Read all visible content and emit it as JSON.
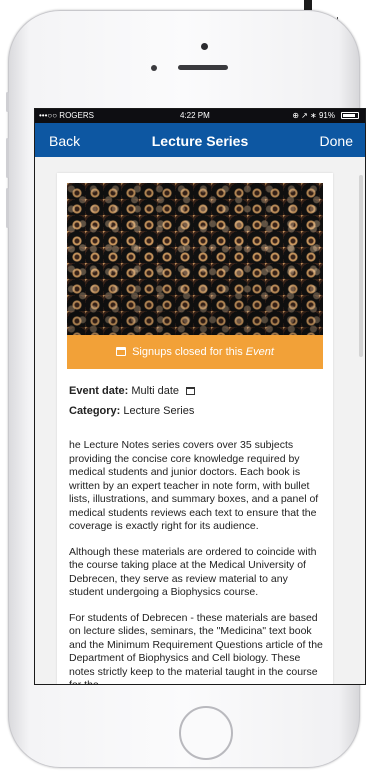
{
  "background_fragment": {
    "text": "ı"
  },
  "statusbar": {
    "carrier": "•••○○ ROGERS",
    "time": "4:22 PM",
    "right": "⊕ ↗ ∗ 91%"
  },
  "navbar": {
    "back": "Back",
    "title": "Lecture Series",
    "done": "Done"
  },
  "event": {
    "signup_text": "Signups closed for this",
    "signup_emphasis": "Event",
    "date_label": "Event date:",
    "date_value": "Multi date",
    "category_label": "Category:",
    "category_value": "Lecture Series"
  },
  "description": {
    "p1": "he Lecture Notes series covers over 35 subjects providing the concise core knowledge required by medical students and junior doctors. Each book is written by an expert teacher in note form, with bullet lists, illustrations, and summary boxes, and a panel of medical students reviews each text to ensure that the coverage is exactly right for its audience.",
    "p2": "Although these materials are ordered to coincide with the course taking place at the Medical University of Debrecen, they serve as review material to any student undergoing a Biophysics course.",
    "p3": "For students of Debrecen - these materials are based on lecture slides, seminars, the \"Medicina\" text book and the Minimum Requirement Questions article of the Department of Biophysics and Cell biology. These notes strictly keep to the material taught in the course for the"
  },
  "icons": {
    "calendar": "calendar-icon",
    "battery": "battery-icon"
  },
  "colors": {
    "nav_blue": "#0d57a2",
    "signup_orange": "#f2a138"
  }
}
